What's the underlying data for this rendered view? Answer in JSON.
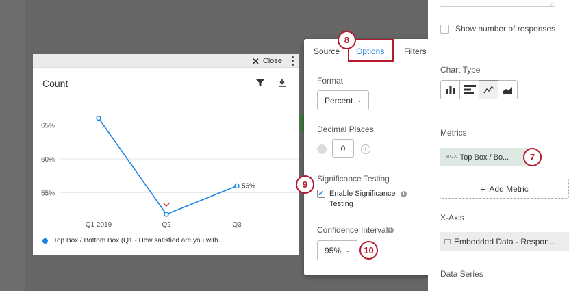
{
  "widget": {
    "close_label": "Close",
    "title": "Count",
    "legend": "Top Box / Bottom Box (Q1 - How satisfied are you with..."
  },
  "chart_data": {
    "type": "line",
    "title": "Count",
    "categories": [
      "Q1 2019",
      "Q2",
      "Q3"
    ],
    "series": [
      {
        "name": "Top Box / Bottom Box (Q1 - How satisfied are you with...",
        "values": [
          66,
          51.8,
          56
        ],
        "color": "#1a82e2"
      }
    ],
    "y_ticks": [
      "65%",
      "60%",
      "55%"
    ],
    "y_tick_values": [
      65,
      60,
      55
    ],
    "ylim": [
      52,
      69
    ],
    "data_labels": {
      "Q3": "56%"
    },
    "significance_marker": {
      "category": "Q2",
      "direction": "down",
      "color": "#d62728"
    },
    "grid": true
  },
  "options": {
    "tabs": [
      "Source",
      "Options",
      "Filters"
    ],
    "active_tab": "Options",
    "format_label": "Format",
    "format_value": "Percent",
    "decimal_label": "Decimal Places",
    "decimal_value": "0",
    "significance_label": "Significance Testing",
    "enable_sig_label": "Enable Significance Testing",
    "enable_sig_checked": true,
    "confidence_label": "Confidence Interval",
    "confidence_value": "95%"
  },
  "callouts": [
    "7",
    "8",
    "9",
    "10"
  ],
  "right_panel": {
    "show_responses_label": "Show number of responses",
    "chart_type_label": "Chart Type",
    "chart_types": [
      "bar-chart-icon",
      "horizontal-bar-icon",
      "line-chart-icon",
      "area-chart-icon"
    ],
    "active_chart_type": "line-chart-icon",
    "metrics_label": "Metrics",
    "metric_tag": "BOX",
    "metric_item": "Top Box / Bo...",
    "add_metric_label": "Add Metric",
    "xaxis_label": "X-Axis",
    "xaxis_item": "Embedded Data - Respon...",
    "data_series_label": "Data Series"
  }
}
